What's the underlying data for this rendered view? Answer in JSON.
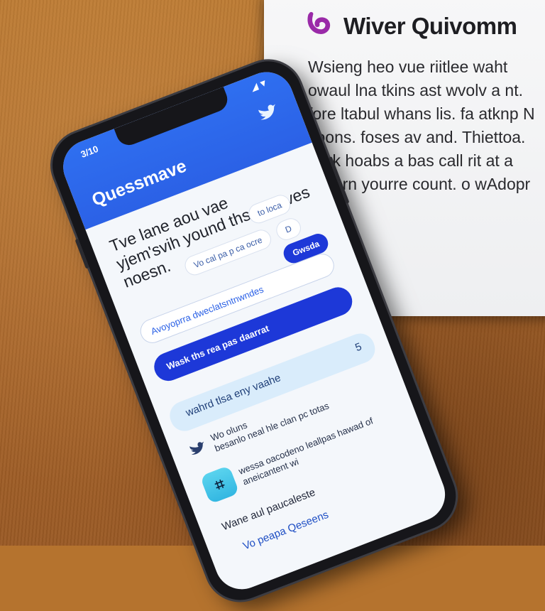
{
  "paper": {
    "title": "Wiver Quivomm",
    "lines": [
      "Wsieng heo vue riitlee waht",
      "owaul lna tkins ast wvolv a nt.",
      "fore ltabul whans lis. fa atknp N",
      "coons. foses av and. Thiettoa.",
      "lwak hoabs a bas call rit at a",
      "wutern yourre count. o wAdopr"
    ],
    "logo_color": "#9a2aa8"
  },
  "phone": {
    "status_time": "3/10",
    "status_icons": "◢▼",
    "header_title": "Quessmave",
    "body_lines": [
      "Tve lane aou vae",
      "yjem'svih yound ths wiahves",
      "noesn."
    ],
    "chip_1": "Vo cal pa p ca ocre",
    "chip_2": "D",
    "chip_3": "to loca",
    "field_text": "Avoyoprra dweclatsntnwndes",
    "field_right": "Gwsda",
    "button_label": "Wask ths rea pas daarrat",
    "card_1_text": "wahrd tlsa eny vaahe",
    "card_1_suffix": "5",
    "row_1_lines": [
      "Wo oluns",
      "besanlo neal hle clan pc totas"
    ],
    "teal_icon_glyph": "⌗",
    "row_2_lines": [
      "wessa oacodeno leallpas hawad of",
      "aneicantent wi"
    ],
    "row_3_text": "Wane aul paucaleste",
    "row_4_text": "Vo peapa Qeseens",
    "accent": "#2b61e6",
    "button_color": "#1d38d8"
  }
}
